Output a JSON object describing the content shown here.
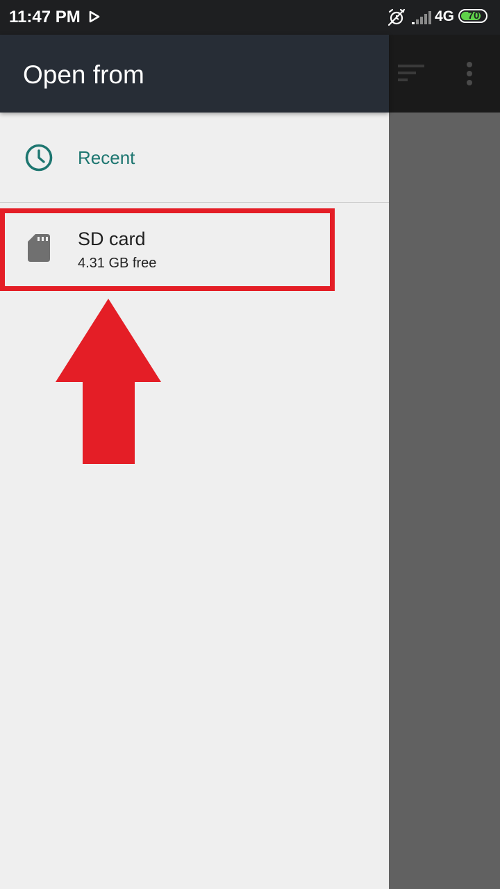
{
  "status_bar": {
    "time": "11:47 PM",
    "network": "4G",
    "battery": "70",
    "icons": [
      "play-icon",
      "alarm-off-icon",
      "signal-icon",
      "battery-icon"
    ]
  },
  "behind": {
    "icons": [
      "sort-icon",
      "overflow-menu-icon"
    ]
  },
  "drawer": {
    "title": "Open from",
    "items": [
      {
        "label": "Recent",
        "icon": "clock-icon"
      },
      {
        "label": "SD card",
        "sublabel": "4.31 GB free",
        "icon": "sd-card-icon"
      }
    ]
  },
  "colors": {
    "accent": "#1d7670",
    "header": "#272d36",
    "annotation": "#e41e26"
  }
}
